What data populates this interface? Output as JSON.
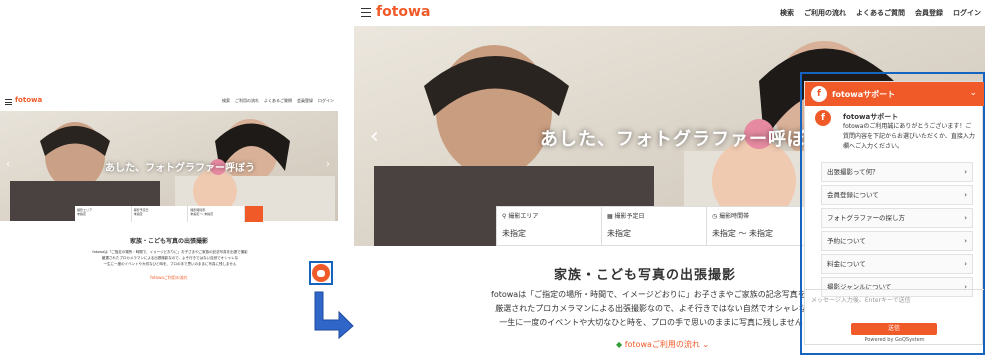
{
  "brand": {
    "logo": "fotowa",
    "accent": "#f05a28",
    "frame": "#1565c0"
  },
  "nav": [
    "検索",
    "ご利用の流れ",
    "よくあるご質問",
    "会員登録",
    "ログイン"
  ],
  "hero": {
    "catch": "あした、フォトグラファー呼ぼう"
  },
  "search": {
    "fields": [
      {
        "label": "撮影エリア",
        "value": "未指定"
      },
      {
        "label": "撮影予定日",
        "value": "未指定"
      },
      {
        "label": "撮影時間帯",
        "value": "未指定 〜 未指定"
      }
    ]
  },
  "section": {
    "title": "家族・こども写真の出張撮影",
    "desc": [
      "fotowaは「ご指定の場所・時間で、イメージどおりに」お子さまやご家族の記念写真を出張で撮影",
      "厳選されたプロカメラマンによる出張撮影なので、よそ行きではない自然でオシャレな",
      "一生に一度のイベントや大切なひと時を、プロの手で思いのままに写真に残しません"
    ],
    "flow_link": "fotowaご利用の流れ"
  },
  "chat": {
    "title": "fotowaサポート",
    "sender": "fotowaサポート",
    "message": "fotowaのご利用誠にありがとうございます！ご質問内容を下記からお選びいただくか、直接入力欄へご入力ください。",
    "menu": [
      "出張撮影って何？",
      "会員登録について",
      "フォトグラファーの探し方",
      "予約について",
      "料金について",
      "撮影ジャンルについて"
    ],
    "input_placeholder": "メッセージ入力後、Enterキーで送信",
    "send_label": "送信",
    "powered": "Powered by GoQSystem"
  }
}
